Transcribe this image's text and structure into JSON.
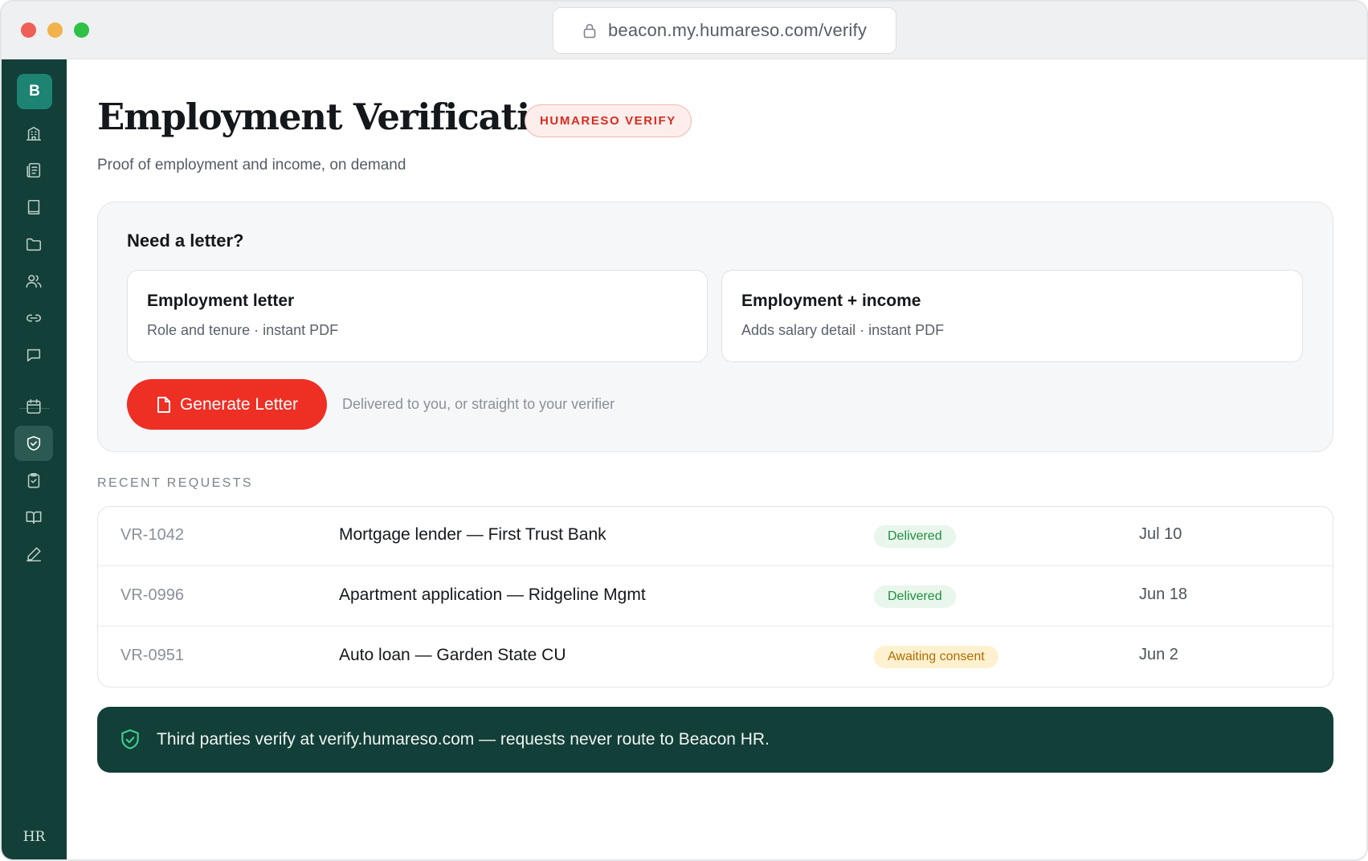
{
  "browser": {
    "url": "beacon.my.humareso.com/verify"
  },
  "sidebar": {
    "logo": "B",
    "items": [
      {
        "icon": "building-icon"
      },
      {
        "icon": "document-list-icon"
      },
      {
        "icon": "book-icon"
      },
      {
        "icon": "folder-icon"
      },
      {
        "icon": "people-icon"
      },
      {
        "icon": "link-icon"
      },
      {
        "icon": "chat-icon"
      },
      {
        "icon": "calendar-icon"
      },
      {
        "icon": "shield-check-icon",
        "active": true
      },
      {
        "icon": "clipboard-check-icon"
      },
      {
        "icon": "open-book-icon"
      },
      {
        "icon": "pen-icon"
      }
    ],
    "footer_mark": "HR"
  },
  "header": {
    "title": "Employment Verification",
    "badge": "HUMARESO VERIFY",
    "subtitle": "Proof of employment and income, on demand"
  },
  "letter_card": {
    "title": "Need a letter?",
    "options": [
      {
        "title": "Employment letter",
        "description": "Role and tenure · instant PDF"
      },
      {
        "title": "Employment + income",
        "description": "Adds salary detail · instant PDF"
      }
    ],
    "button_label": "Generate Letter",
    "note": "Delivered to you, or straight to your verifier"
  },
  "recent": {
    "label": "RECENT REQUESTS",
    "rows": [
      {
        "id": "VR-1042",
        "description": "Mortgage lender — First Trust Bank",
        "status": "Delivered",
        "date": "Jul 10"
      },
      {
        "id": "VR-0996",
        "description": "Apartment application — Ridgeline Mgmt",
        "status": "Delivered",
        "date": "Jun 18"
      },
      {
        "id": "VR-0951",
        "description": "Auto loan — Garden State CU",
        "status": "Awaiting consent",
        "date": "Jun 2"
      }
    ]
  },
  "banner": {
    "text": "Third parties verify at verify.humareso.com — requests never route to Beacon HR."
  },
  "colors": {
    "sidebar": "#123f38",
    "accent": "#ee2f24",
    "delivered": "#1f8f3e",
    "awaiting": "#b26b00"
  }
}
